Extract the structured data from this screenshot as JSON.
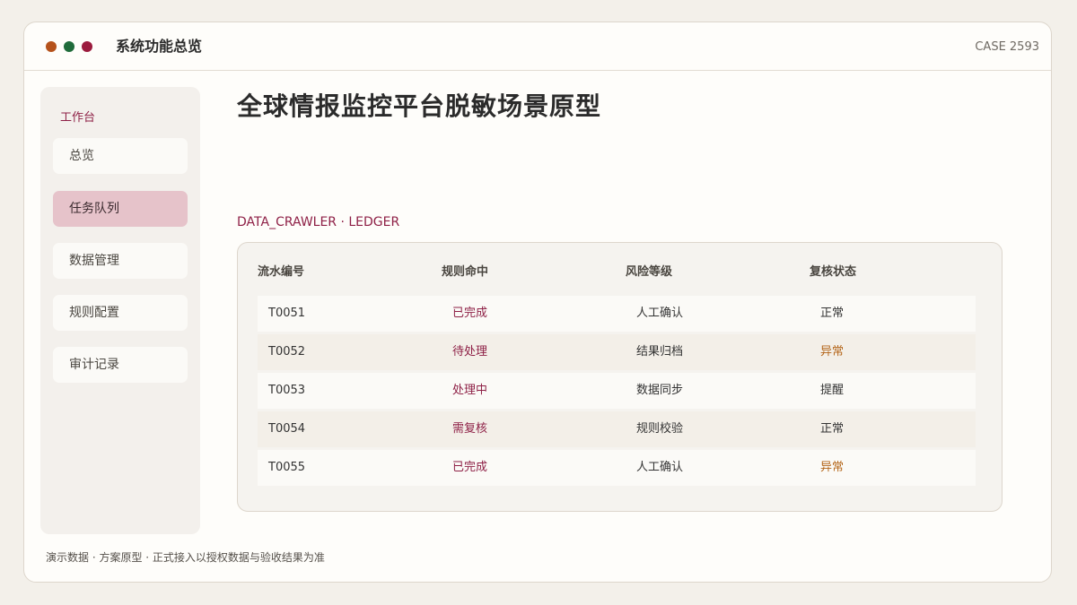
{
  "window": {
    "title": "系统功能总览",
    "case_label": "CASE 2593",
    "dot_colors": [
      "#b5521b",
      "#1f6b3a",
      "#9b1b3d"
    ]
  },
  "sidebar": {
    "header": "工作台",
    "items": [
      {
        "label": "总览",
        "active": false
      },
      {
        "label": "任务队列",
        "active": true
      },
      {
        "label": "数据管理",
        "active": false
      },
      {
        "label": "规则配置",
        "active": false
      },
      {
        "label": "审计记录",
        "active": false
      }
    ]
  },
  "main": {
    "title": "全球情报监控平台脱敏场景原型",
    "section_label": "DATA_CRAWLER · LEDGER",
    "table": {
      "headers": [
        "流水编号",
        "规则命中",
        "风险等级",
        "复核状态"
      ],
      "rows": [
        {
          "id": "T0051",
          "rule": "已完成",
          "risk": "人工确认",
          "status": "正常"
        },
        {
          "id": "T0052",
          "rule": "待处理",
          "risk": "结果归档",
          "status": "异常"
        },
        {
          "id": "T0053",
          "rule": "处理中",
          "risk": "数据同步",
          "status": "提醒"
        },
        {
          "id": "T0054",
          "rule": "需复核",
          "risk": "规则校验",
          "status": "正常"
        },
        {
          "id": "T0055",
          "rule": "已完成",
          "risk": "人工确认",
          "status": "异常"
        }
      ]
    }
  },
  "footer": {
    "note": "演示数据 · 方案原型 · 正式接入以授权数据与验收结果为准"
  },
  "colors": {
    "accent": "#8e2046",
    "warning": "#b4661a",
    "active_nav": "#e6c3ca"
  }
}
